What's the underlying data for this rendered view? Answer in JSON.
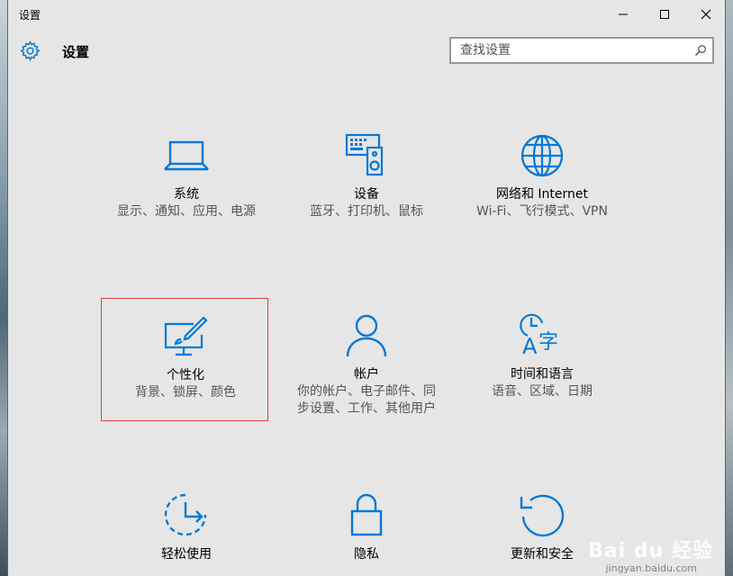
{
  "window": {
    "title": "设置",
    "minimize_glyph": "—",
    "maximize_glyph": "☐",
    "close_glyph": "✕"
  },
  "header": {
    "title": "设置",
    "icon": "gear-icon"
  },
  "search": {
    "placeholder": "查找设置",
    "icon": "search-icon"
  },
  "accent": "#0078d7",
  "tiles": [
    {
      "title": "系统",
      "desc": "显示、通知、应用、电源",
      "icon": "laptop-icon"
    },
    {
      "title": "设备",
      "desc": "蓝牙、打印机、鼠标",
      "icon": "devices-icon"
    },
    {
      "title": "网络和 Internet",
      "desc": "Wi-Fi、飞行模式、VPN",
      "icon": "globe-icon"
    },
    {
      "title": "个性化",
      "desc": "背景、锁屏、颜色",
      "icon": "personalization-icon"
    },
    {
      "title": "帐户",
      "desc": "你的帐户、电子邮件、同步设置、工作、其他用户",
      "icon": "person-icon"
    },
    {
      "title": "时间和语言",
      "desc": "语音、区域、日期",
      "icon": "time-language-icon"
    },
    {
      "title": "轻松使用",
      "desc": "",
      "icon": "ease-of-access-icon"
    },
    {
      "title": "隐私",
      "desc": "",
      "icon": "lock-icon"
    },
    {
      "title": "更新和安全",
      "desc": "",
      "icon": "update-icon"
    }
  ],
  "watermark": {
    "brand": "Bai du 经验",
    "url": "jingyan.baidu.com"
  }
}
